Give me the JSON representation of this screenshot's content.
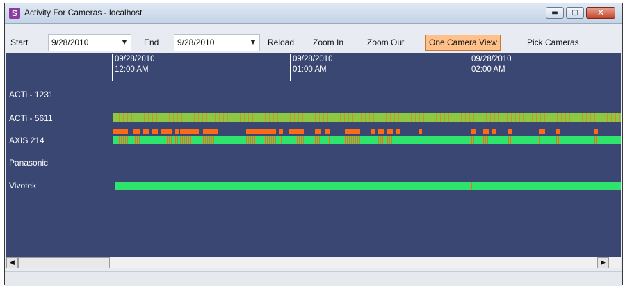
{
  "window": {
    "title": "Activity For Cameras - localhost",
    "app_icon_letter": "S",
    "min_glyph": "▬",
    "max_glyph": "▢",
    "close_glyph": "✕"
  },
  "toolbar": {
    "start_label": "Start",
    "start_date": "9/28/2010",
    "end_label": "End",
    "end_date": "9/28/2010",
    "dropdown_glyph": "▼",
    "reload_label": "Reload",
    "zoom_in_label": "Zoom In",
    "zoom_out_label": "Zoom Out",
    "one_camera_view_label": "One Camera View",
    "pick_cameras_label": "Pick Cameras"
  },
  "timeline": {
    "background": "#3b4773",
    "ticks": [
      "09/28/2010\n12:00 AM",
      "09/28/2010\n01:00 AM",
      "09/28/2010\n02:00 AM"
    ],
    "cameras": [
      "ACTi - 1231",
      "ACTi - 5611",
      "AXIS 214",
      "Panasonic",
      "Vivotek"
    ],
    "colors": {
      "activity_green": "#2ee46c",
      "motion_orange": "#ff6a14",
      "olive_green": "#8cc844"
    }
  },
  "scrollbar": {
    "left_arrow": "◀",
    "right_arrow": "▶"
  }
}
